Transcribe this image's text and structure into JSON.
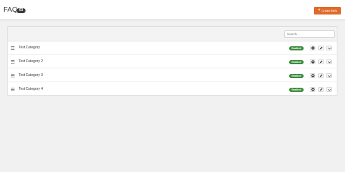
{
  "header": {
    "title": "FAQ",
    "count": "03",
    "create_button": "Create New"
  },
  "search": {
    "placeholder": "Search..."
  },
  "rows": [
    {
      "label": "Test Category",
      "status": "Enabled"
    },
    {
      "label": "Test Category 2",
      "status": "Enabled"
    },
    {
      "label": "Test Category 3",
      "status": "Enabled"
    },
    {
      "label": "Test Category 4",
      "status": "Enabled"
    }
  ],
  "colors": {
    "accent": "#e06a29",
    "status_enabled": "#3d8b3d",
    "badge": "#3a3a3a"
  },
  "icons": [
    "plus-icon",
    "drag-handle-icon",
    "toggle-icon",
    "pencil-icon",
    "chevron-down-icon"
  ]
}
